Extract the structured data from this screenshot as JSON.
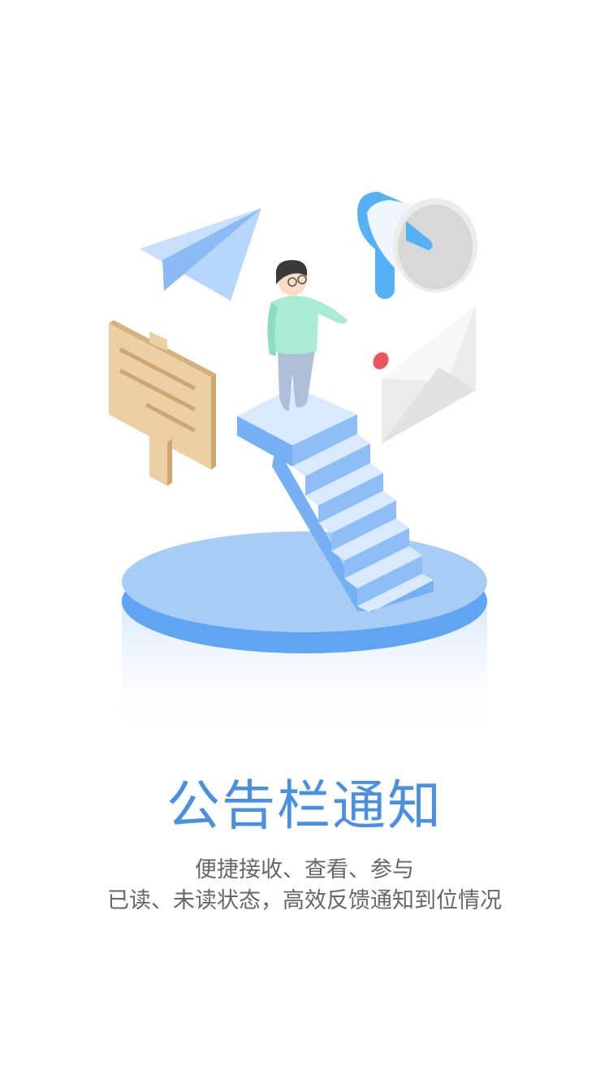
{
  "screen": {
    "title": "公告栏通知",
    "description_line1": "便捷接收、查看、参与",
    "description_line2": "已读、未读状态，高效反馈通知到位情况"
  },
  "illustration": {
    "icons": [
      "paper-plane-icon",
      "megaphone-icon",
      "envelope-icon",
      "signboard-icon",
      "person-icon",
      "staircase-icon",
      "platform-icon"
    ],
    "colors": {
      "accent": "#4a90e2",
      "platform": "#a7cdf6",
      "platform_edge": "#5fa5f2",
      "sign": "#eccfa3",
      "shirt": "#a9ecd3",
      "envelope_seal": "#e9565d"
    }
  }
}
